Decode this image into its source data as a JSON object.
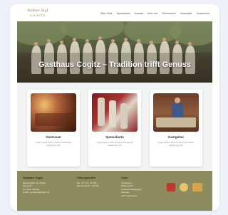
{
  "logo": {
    "script": "Kolbes Sigl",
    "sub": "COGITZ"
  },
  "nav": [
    "Start Seite",
    "Speisekarte",
    "Kontakt",
    "Über uns",
    "Reservieren",
    "Veranstalt.",
    "Gutscheine"
  ],
  "hero": {
    "title": "Gasthaus Cogitz – Tradition trifft Genuss"
  },
  "features": [
    {
      "title": "Gastraum",
      "text": "Lorem ipsum dolor sit amet consetetur sadipscing elitr"
    },
    {
      "title": "Speisekarte",
      "text": "Lorem ipsum dolor sit amet consetetur sadipscing elitr"
    },
    {
      "title": "Gastgeber",
      "text": "Lorem ipsum dolor sit amet consetetur sadipscing elitr"
    }
  ],
  "footer": {
    "col1": {
      "head": "Gasthaus Cogitz",
      "lines": [
        "Musterstraße 12, 01234",
        "Musterort",
        "Tel. 0123 456789",
        "E-Mail: gasthaus@cogitz.de"
      ]
    },
    "col2": {
      "head": "Öffnungszeiten",
      "lines": [
        "Mo – Fr: 11 – 22 Uhr",
        "Sa, So: ab 10 – 23 Uhr"
      ]
    },
    "col3": {
      "head": "Links",
      "lines": [
        "Impressum",
        "Datenschutz",
        "Cookie-Einstellungen",
        "Sitemap",
        "Jetzt reservieren"
      ]
    }
  },
  "colors": {
    "footer": "#8d8c5e",
    "accent": "#8a7a55"
  }
}
